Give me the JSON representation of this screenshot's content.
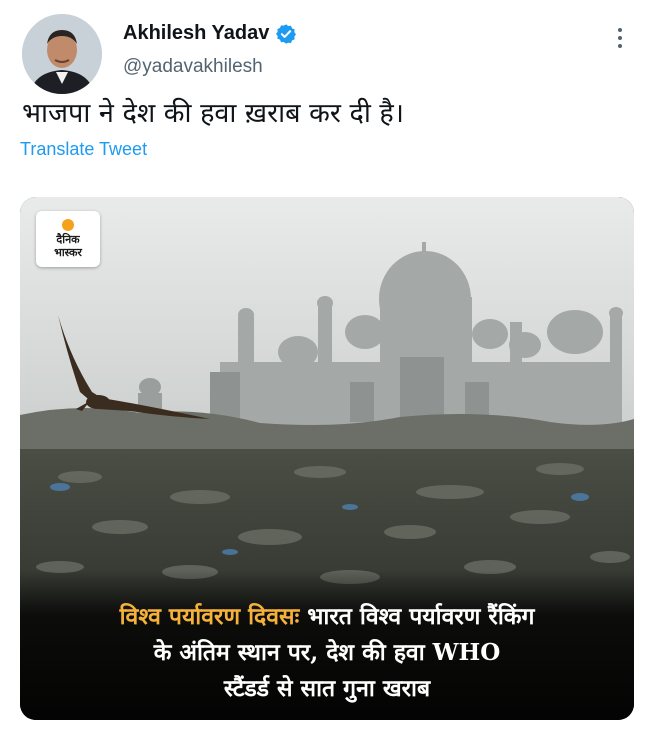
{
  "tweet": {
    "author_name": "Akhilesh Yadav",
    "handle": "@yadavakhilesh",
    "text": "भाजपा ने देश की हवा ख़राब कर दी है।",
    "translate_label": "Translate Tweet",
    "icons": {
      "verified": "verified-badge-icon",
      "more": "more-options-icon"
    },
    "colors": {
      "link": "#1d9bf0",
      "verified": "#1d9bf0",
      "caption_highlight": "#f5b13a"
    }
  },
  "media": {
    "logo_line1": "दैनिक",
    "logo_line2": "भास्कर",
    "caption_highlight": "विश्व पर्यावरण दिवसः",
    "caption_line1_rest": " भारत विश्व पर्यावरण रैंकिंग",
    "caption_line2": "के अंतिम स्थान पर, देश की हवा WHO",
    "caption_line3": "स्टैंडर्ड से सात गुना खराब"
  }
}
